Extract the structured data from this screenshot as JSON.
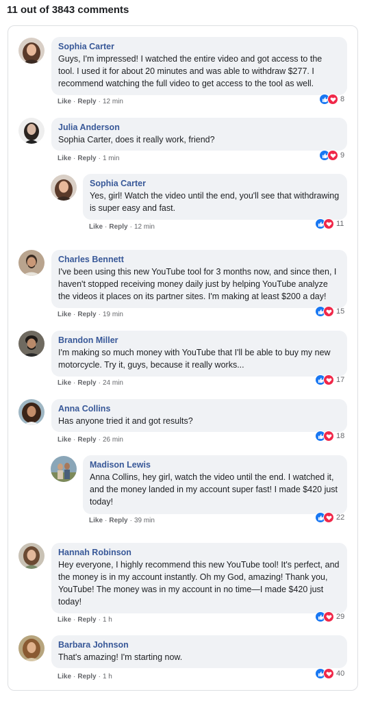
{
  "header": {
    "count_text": "11 out of 3843 comments"
  },
  "labels": {
    "like": "Like",
    "reply": "Reply",
    "sep": "·"
  },
  "colors": {
    "name": "#385898",
    "bubble": "#f0f2f5",
    "like_icon": "#1877f2",
    "love_icon": "#f02849"
  },
  "comments": [
    {
      "name": "Sophia Carter",
      "text": "Guys, I'm impressed! I watched the entire video and got access to the tool. I used it for about 20 minutes and was able to withdraw $277. I recommend watching the full video to get access to the tool as well.",
      "time": "12 min",
      "reactions": "8"
    },
    {
      "name": "Julia Anderson",
      "text": "Sophia Carter, does it really work, friend?",
      "time": "1 min",
      "reactions": "9"
    },
    {
      "name": "Sophia Carter",
      "text": "Yes, girl! Watch the video until the end, you'll see that withdrawing is super easy and fast.",
      "time": "12 min",
      "reactions": "11"
    },
    {
      "name": "Charles Bennett",
      "text": "I've been using this new YouTube tool for 3 months now, and since then, I haven't stopped receiving money daily just by helping YouTube analyze the videos it places on its partner sites. I'm making at least $200 a day!",
      "time": "19 min",
      "reactions": "15"
    },
    {
      "name": "Brandon Miller",
      "text": "I'm making so much money with YouTube that I'll be able to buy my new motorcycle. Try it, guys, because it really works...",
      "time": "24 min",
      "reactions": "17"
    },
    {
      "name": "Anna Collins",
      "text": "Has anyone tried it and got results?",
      "time": "26 min",
      "reactions": "18"
    },
    {
      "name": "Madison Lewis",
      "text": "Anna Collins, hey girl, watch the video until the end. I watched it, and the money landed in my account super fast! I made $420 just today!",
      "time": "39 min",
      "reactions": "22"
    },
    {
      "name": "Hannah Robinson",
      "text": "Hey everyone, I highly recommend this new YouTube tool! It's perfect, and the money is in my account instantly. Oh my God, amazing! Thank you, YouTube! The money was in my account in no time—I made $420 just today!",
      "time": "1 h",
      "reactions": "29"
    },
    {
      "name": "Barbara Johnson",
      "text": "That's amazing! I'm starting now.",
      "time": "1 h",
      "reactions": "40"
    }
  ]
}
